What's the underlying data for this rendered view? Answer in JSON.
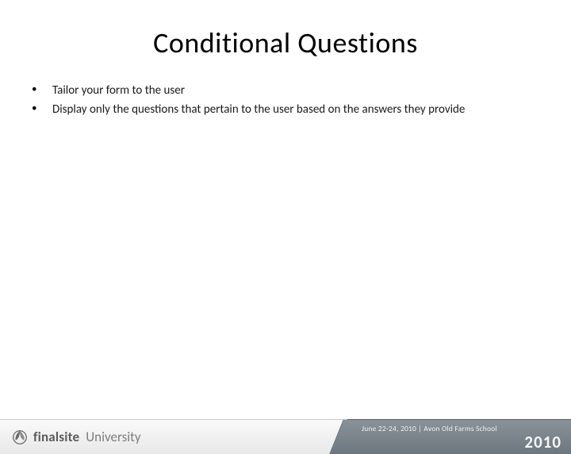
{
  "title": "Conditional Questions",
  "bullets": [
    "Tailor your form to the user",
    "Display only the questions that pertain to the user based on the answers they provide"
  ],
  "footer": {
    "brand_strong": "finalsite",
    "brand_light": "University",
    "event_line": "June 22-24, 2010 | Avon Old Farms School",
    "event_year": "2010"
  }
}
